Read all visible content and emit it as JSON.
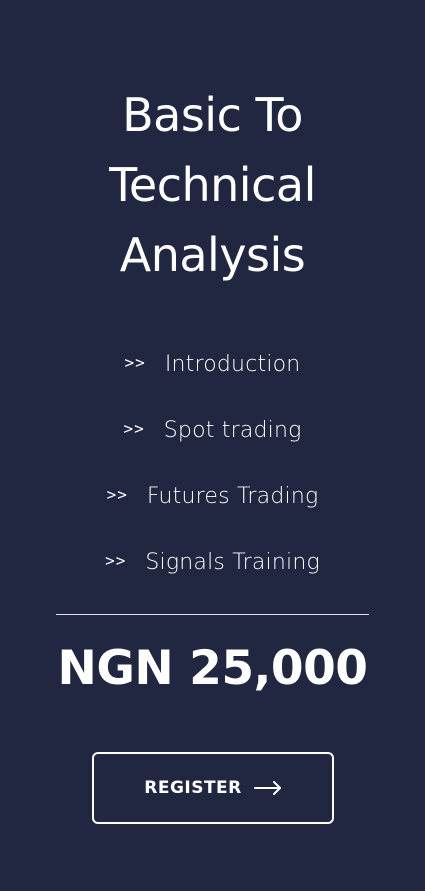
{
  "title": {
    "line1": "Basic To",
    "line2": "Technical",
    "line3": "Analysis"
  },
  "features": [
    {
      "bullet": ">>",
      "label": "Introduction"
    },
    {
      "bullet": ">>",
      "label": "Spot trading"
    },
    {
      "bullet": ">>",
      "label": "Futures Trading"
    },
    {
      "bullet": ">>",
      "label": "Signals Training"
    }
  ],
  "price": "NGN 25,000",
  "register": {
    "label": "REGISTER",
    "icon": "arrow-right-icon"
  },
  "colors": {
    "background": "#212641",
    "text": "#ffffff"
  }
}
